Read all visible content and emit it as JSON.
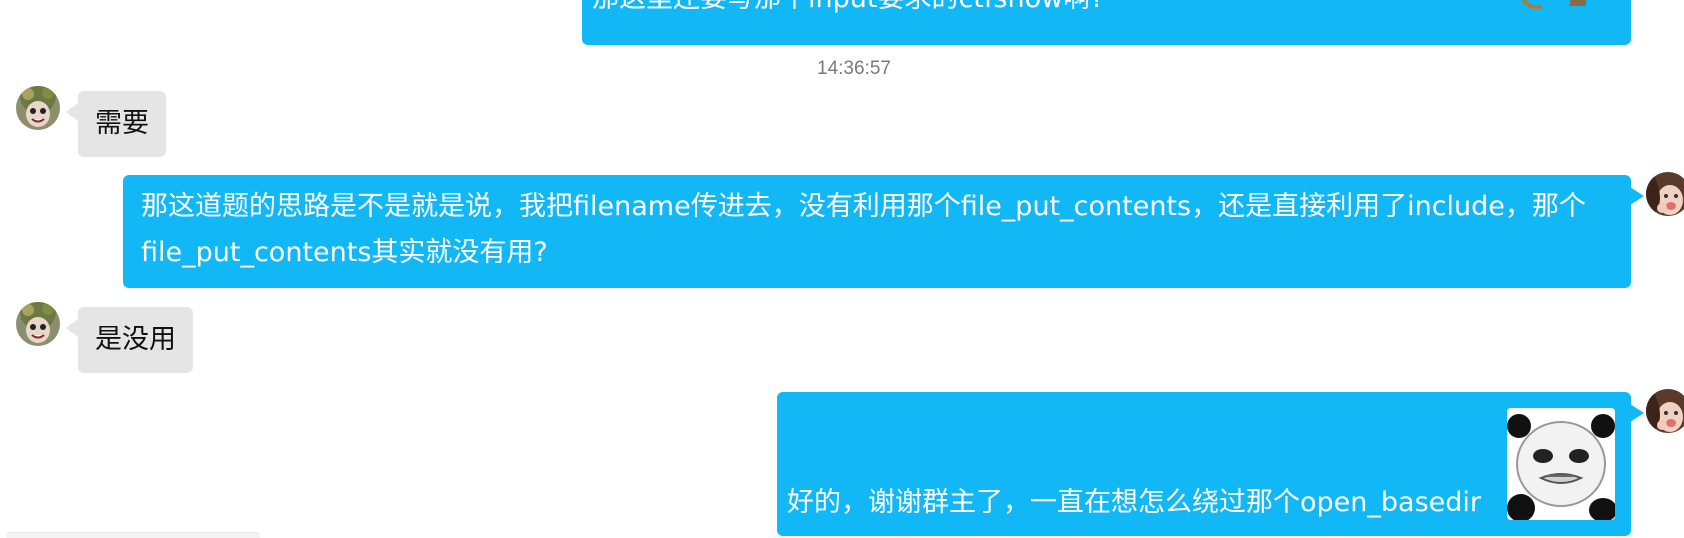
{
  "messages": [
    {
      "type": "outgoing",
      "text": "那这里还要写那个input要求的ctfshow啊?",
      "partial": true
    },
    {
      "type": "timestamp",
      "text": "14:36:57"
    },
    {
      "type": "incoming",
      "text": "需要"
    },
    {
      "type": "outgoing",
      "line1": "那这道题的思路是不是就是说，我把filename传进去，没有利用那个file_put_contents，还是直接利用了include，那个",
      "line2": "file_put_contents其实就没有用?"
    },
    {
      "type": "incoming",
      "text": "是没用"
    },
    {
      "type": "outgoing",
      "text": "好的，谢谢群主了，一直在想怎么绕过那个open_basedir",
      "sticker": "panda-meme-sticker"
    }
  ],
  "colors": {
    "outgoing_bubble": "#12b7f5",
    "incoming_bubble": "#e5e5e5",
    "timestamp": "#7a7a7a"
  }
}
